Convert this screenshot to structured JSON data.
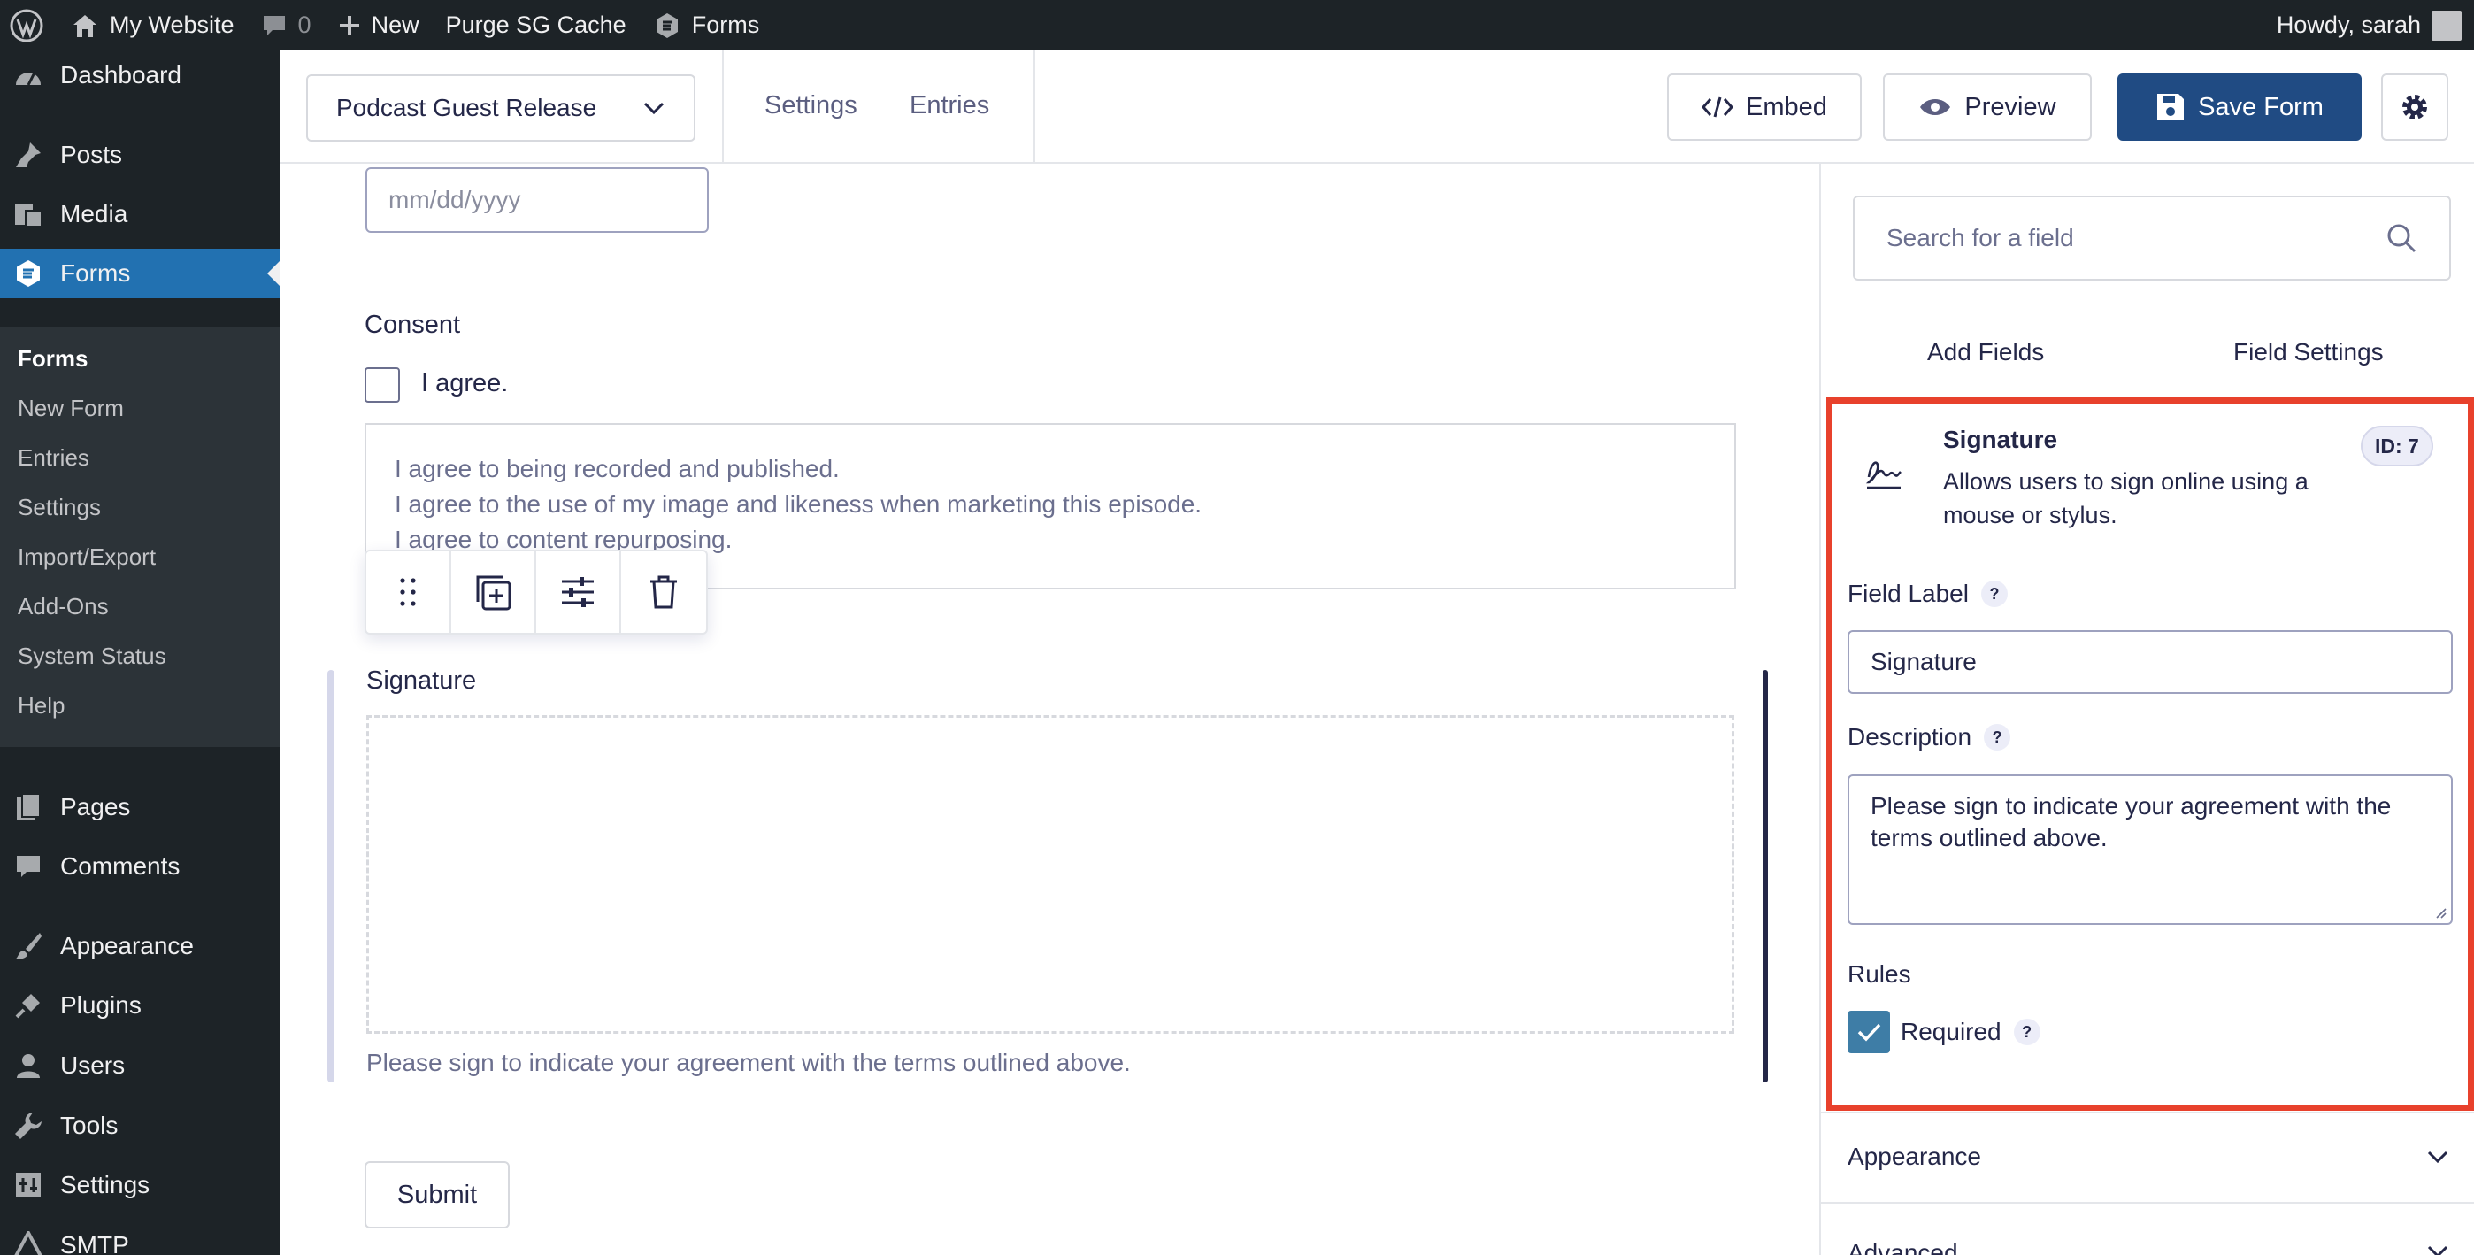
{
  "admin_bar": {
    "site_name": "My Website",
    "comments_count": "0",
    "new_label": "New",
    "cache_label": "Purge SG Cache",
    "forms_label": "Forms",
    "greeting": "Howdy, sarah"
  },
  "sidebar": {
    "items": [
      {
        "label": "Dashboard",
        "icon": "dashboard-icon"
      },
      {
        "label": "Posts",
        "icon": "pin-icon"
      },
      {
        "label": "Media",
        "icon": "media-icon"
      },
      {
        "label": "Forms",
        "icon": "gravity-forms-icon"
      },
      {
        "label": "Pages",
        "icon": "pages-icon"
      },
      {
        "label": "Comments",
        "icon": "comment-icon"
      },
      {
        "label": "Appearance",
        "icon": "brush-icon"
      },
      {
        "label": "Plugins",
        "icon": "plug-icon"
      },
      {
        "label": "Users",
        "icon": "user-icon"
      },
      {
        "label": "Tools",
        "icon": "wrench-icon"
      },
      {
        "label": "Settings",
        "icon": "settings-icon"
      },
      {
        "label": "SMTP",
        "icon": "smtp-icon"
      }
    ],
    "forms_submenu": [
      "Forms",
      "New Form",
      "Entries",
      "Settings",
      "Import/Export",
      "Add-Ons",
      "System Status",
      "Help"
    ]
  },
  "header": {
    "form_name": "Podcast Guest Release",
    "links": [
      "Settings",
      "Entries"
    ],
    "embed_label": "Embed",
    "preview_label": "Preview",
    "save_label": "Save Form"
  },
  "canvas": {
    "date_placeholder": "mm/dd/yyyy",
    "consent_label": "Consent",
    "consent_checkbox_label": "I agree.",
    "consent_lines": [
      "I agree to being recorded and published.",
      "I agree to the use of my image and likeness when marketing this episode.",
      "I agree to content repurposing."
    ],
    "signature_label": "Signature",
    "signature_description": "Please sign to indicate your agreement with the terms outlined above.",
    "submit_label": "Submit"
  },
  "panel": {
    "search_placeholder": "Search for a field",
    "tabs": [
      "Add Fields",
      "Field Settings"
    ],
    "field_type": "Signature",
    "field_type_description": "Allows users to sign online using a mouse or stylus.",
    "field_id": "ID: 7",
    "field_label_title": "Field Label",
    "field_label_value": "Signature",
    "description_title": "Description",
    "description_value": "Please sign to indicate your agreement with the terms outlined above.",
    "rules_title": "Rules",
    "required_label": "Required",
    "help_glyph": "?",
    "sections": [
      "Appearance",
      "Advanced"
    ]
  },
  "colors": {
    "highlight": "#e8412c",
    "primary": "#204b83",
    "wp_blue": "#2271b1"
  }
}
